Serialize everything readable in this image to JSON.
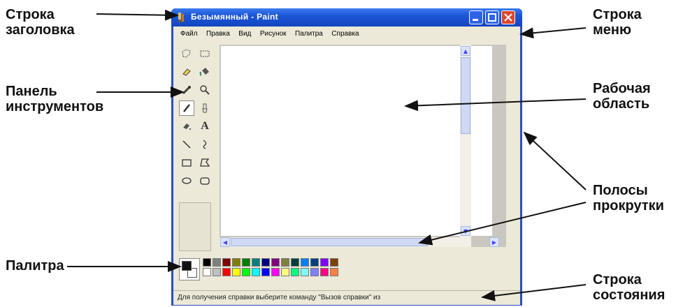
{
  "labels": {
    "title_bar": "Строка заголовка",
    "toolbox": "Панель инструментов",
    "palette": "Палитра",
    "menu_bar": "Строка меню",
    "work_area": "Рабочая область",
    "scrollbars": "Полосы прокрутки",
    "status_bar": "Строка состояния"
  },
  "window": {
    "title": "Безымянный - Paint",
    "menu": [
      "Файл",
      "Правка",
      "Вид",
      "Рисунок",
      "Палитра",
      "Справка"
    ],
    "status": "Для получения справки выберите команду \"Вызов справки\" из"
  },
  "tools": [
    "free-select-icon",
    "rect-select-icon",
    "eraser-icon",
    "fill-bucket-icon",
    "color-picker-icon",
    "magnifier-icon",
    "pencil-icon",
    "brush-icon",
    "airbrush-icon",
    "text-icon",
    "line-icon",
    "curve-icon",
    "rectangle-icon",
    "polygon-icon",
    "ellipse-icon",
    "rounded-rect-icon"
  ],
  "palette_colors": [
    [
      "#000000",
      "#808080",
      "#800000",
      "#808000",
      "#008000",
      "#008080",
      "#000080",
      "#800080",
      "#808040",
      "#004040",
      "#0080ff",
      "#004080",
      "#8000ff",
      "#804000"
    ],
    [
      "#ffffff",
      "#c0c0c0",
      "#ff0000",
      "#ffff00",
      "#00ff00",
      "#00ffff",
      "#0000ff",
      "#ff00ff",
      "#ffff80",
      "#00ff80",
      "#80ffff",
      "#8080ff",
      "#ff0080",
      "#ff8040"
    ]
  ]
}
